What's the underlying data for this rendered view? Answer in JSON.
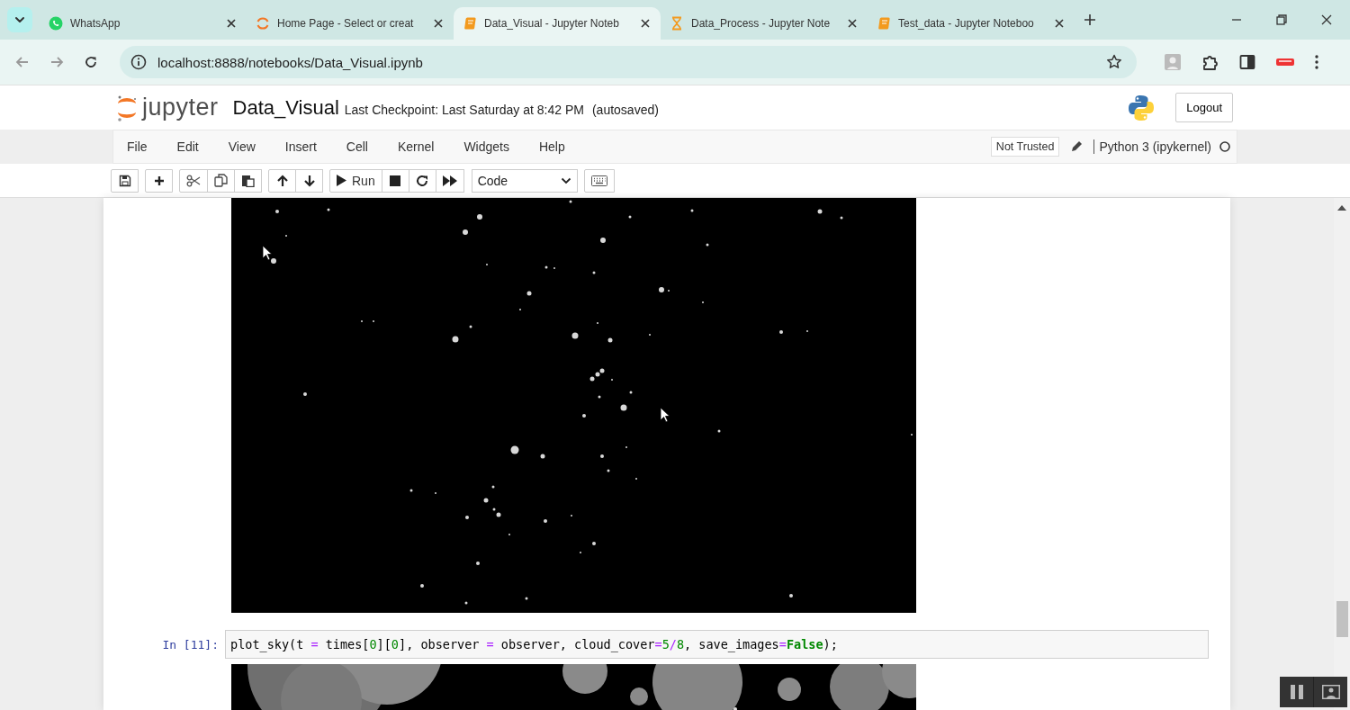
{
  "browser": {
    "tabs": [
      {
        "title": "WhatsApp",
        "selected": false
      },
      {
        "title": "Home Page - Select or creat",
        "selected": false
      },
      {
        "title": "Data_Visual - Jupyter Noteb",
        "selected": true
      },
      {
        "title": "Data_Process - Jupyter Note",
        "selected": false
      },
      {
        "title": "Test_data - Jupyter Noteboo",
        "selected": false
      }
    ],
    "url": "localhost:8888/notebooks/Data_Visual.ipynb"
  },
  "header": {
    "logo": "jupyter",
    "notebook_name": "Data_Visual",
    "checkpoint": "Last Checkpoint: Last Saturday at 8:42 PM",
    "autosave": "(autosaved)",
    "logout": "Logout"
  },
  "menu": [
    "File",
    "Edit",
    "View",
    "Insert",
    "Cell",
    "Kernel",
    "Widgets",
    "Help"
  ],
  "trust": "Not Trusted",
  "kernel": "Python 3 (ipykernel)",
  "kernel_busy": false,
  "toolbar": {
    "run": "Run",
    "cell_type": "Code"
  },
  "cells": [
    {
      "kind": "stars"
    },
    {
      "kind": "code",
      "prompt": "In [11]:",
      "tokens": [
        {
          "kind": "name",
          "text": "plot_sky(t "
        },
        {
          "kind": "op",
          "text": "="
        },
        {
          "kind": "name",
          "text": " times["
        },
        {
          "kind": "num",
          "text": "0"
        },
        {
          "kind": "name",
          "text": "]["
        },
        {
          "kind": "num",
          "text": "0"
        },
        {
          "kind": "name",
          "text": "], observer "
        },
        {
          "kind": "op",
          "text": "="
        },
        {
          "kind": "name",
          "text": " observer, cloud_cover"
        },
        {
          "kind": "op",
          "text": "="
        },
        {
          "kind": "num",
          "text": "5"
        },
        {
          "kind": "op",
          "text": "/"
        },
        {
          "kind": "num",
          "text": "8"
        },
        {
          "kind": "name",
          "text": ", save_images"
        },
        {
          "kind": "op",
          "text": "="
        },
        {
          "kind": "kw",
          "text": "False"
        },
        {
          "kind": "name",
          "text": ");"
        }
      ]
    },
    {
      "kind": "clouds"
    }
  ]
}
